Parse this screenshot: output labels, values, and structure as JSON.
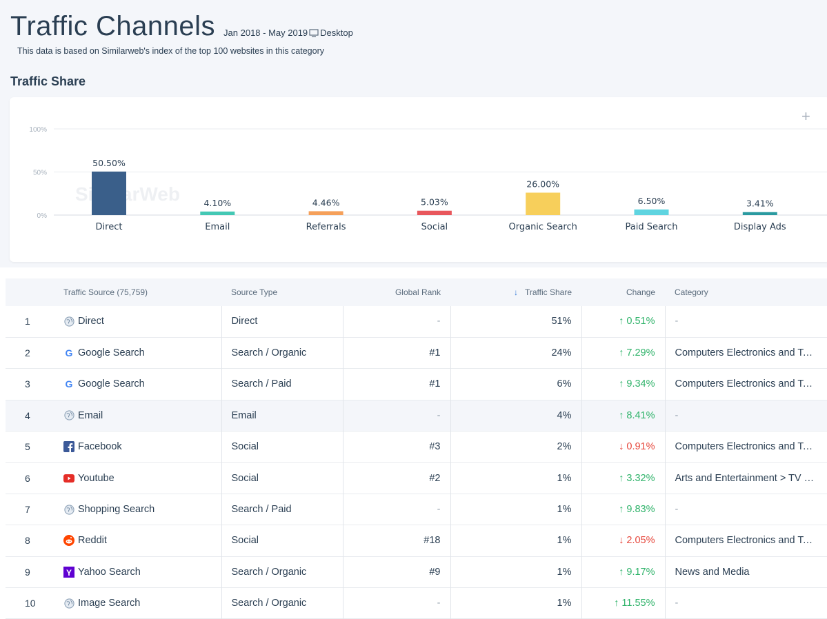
{
  "header": {
    "title": "Traffic Channels",
    "date_range": "Jan 2018 - May 2019",
    "device": "Desktop",
    "subtitle": "This data is based on Similarweb's index of the top 100 websites in this category",
    "section_title": "Traffic Share",
    "watermark": "SimilarWeb"
  },
  "chart_data": {
    "type": "bar",
    "categories": [
      "Direct",
      "Email",
      "Referrals",
      "Social",
      "Organic Search",
      "Paid Search",
      "Display Ads"
    ],
    "values": [
      50.5,
      4.1,
      4.46,
      5.03,
      26.0,
      6.5,
      3.41
    ],
    "labels": [
      "50.50%",
      "4.10%",
      "4.46%",
      "5.03%",
      "26.00%",
      "6.50%",
      "3.41%"
    ],
    "colors": [
      "#3a5f8a",
      "#44c8b4",
      "#f5a05a",
      "#e8575c",
      "#f7cf5b",
      "#5fd4e0",
      "#2a9aa0"
    ],
    "y_ticks": [
      "100%",
      "50%",
      "0%"
    ],
    "ylim": [
      0,
      100
    ],
    "grid": true
  },
  "table": {
    "columns": [
      "",
      "Traffic Source (75,759)",
      "Source Type",
      "Global Rank",
      "Traffic Share",
      "Change",
      "Category"
    ],
    "rows": [
      {
        "n": "1",
        "source": "Direct",
        "icon": "globe-icon",
        "type": "Direct",
        "rank": "-",
        "share": "51%",
        "dir": "up",
        "change": "0.51%",
        "category": "-"
      },
      {
        "n": "2",
        "source": "Google Search",
        "icon": "google-icon",
        "type": "Search / Organic",
        "rank": "#1",
        "share": "24%",
        "dir": "up",
        "change": "7.29%",
        "category": "Computers Electronics and Technology"
      },
      {
        "n": "3",
        "source": "Google Search",
        "icon": "google-icon",
        "type": "Search / Paid",
        "rank": "#1",
        "share": "6%",
        "dir": "up",
        "change": "9.34%",
        "category": "Computers Electronics and Technology"
      },
      {
        "n": "4",
        "source": "Email",
        "icon": "globe-icon",
        "type": "Email",
        "rank": "-",
        "share": "4%",
        "dir": "up",
        "change": "8.41%",
        "category": "-"
      },
      {
        "n": "5",
        "source": "Facebook",
        "icon": "facebook-icon",
        "type": "Social",
        "rank": "#3",
        "share": "2%",
        "dir": "down",
        "change": "0.91%",
        "category": "Computers Electronics and Technology"
      },
      {
        "n": "6",
        "source": "Youtube",
        "icon": "youtube-icon",
        "type": "Social",
        "rank": "#2",
        "share": "1%",
        "dir": "up",
        "change": "3.32%",
        "category": "Arts and Entertainment > TV Movies and Streaming"
      },
      {
        "n": "7",
        "source": "Shopping Search",
        "icon": "globe-icon",
        "type": "Search / Paid",
        "rank": "-",
        "share": "1%",
        "dir": "up",
        "change": "9.83%",
        "category": "-"
      },
      {
        "n": "8",
        "source": "Reddit",
        "icon": "reddit-icon",
        "type": "Social",
        "rank": "#18",
        "share": "1%",
        "dir": "down",
        "change": "2.05%",
        "category": "Computers Electronics and Technology"
      },
      {
        "n": "9",
        "source": "Yahoo Search",
        "icon": "yahoo-icon",
        "type": "Search / Organic",
        "rank": "#9",
        "share": "1%",
        "dir": "up",
        "change": "9.17%",
        "category": "News and Media"
      },
      {
        "n": "10",
        "source": "Image Search",
        "icon": "globe-icon",
        "type": "Search / Organic",
        "rank": "-",
        "share": "1%",
        "dir": "up",
        "change": "11.55%",
        "category": "-"
      }
    ],
    "highlighted_row": 3,
    "sort_column": "Traffic Share"
  },
  "colors": {
    "up": "#2fb36a",
    "down": "#e6483d",
    "accent": "#3b7dd8"
  }
}
